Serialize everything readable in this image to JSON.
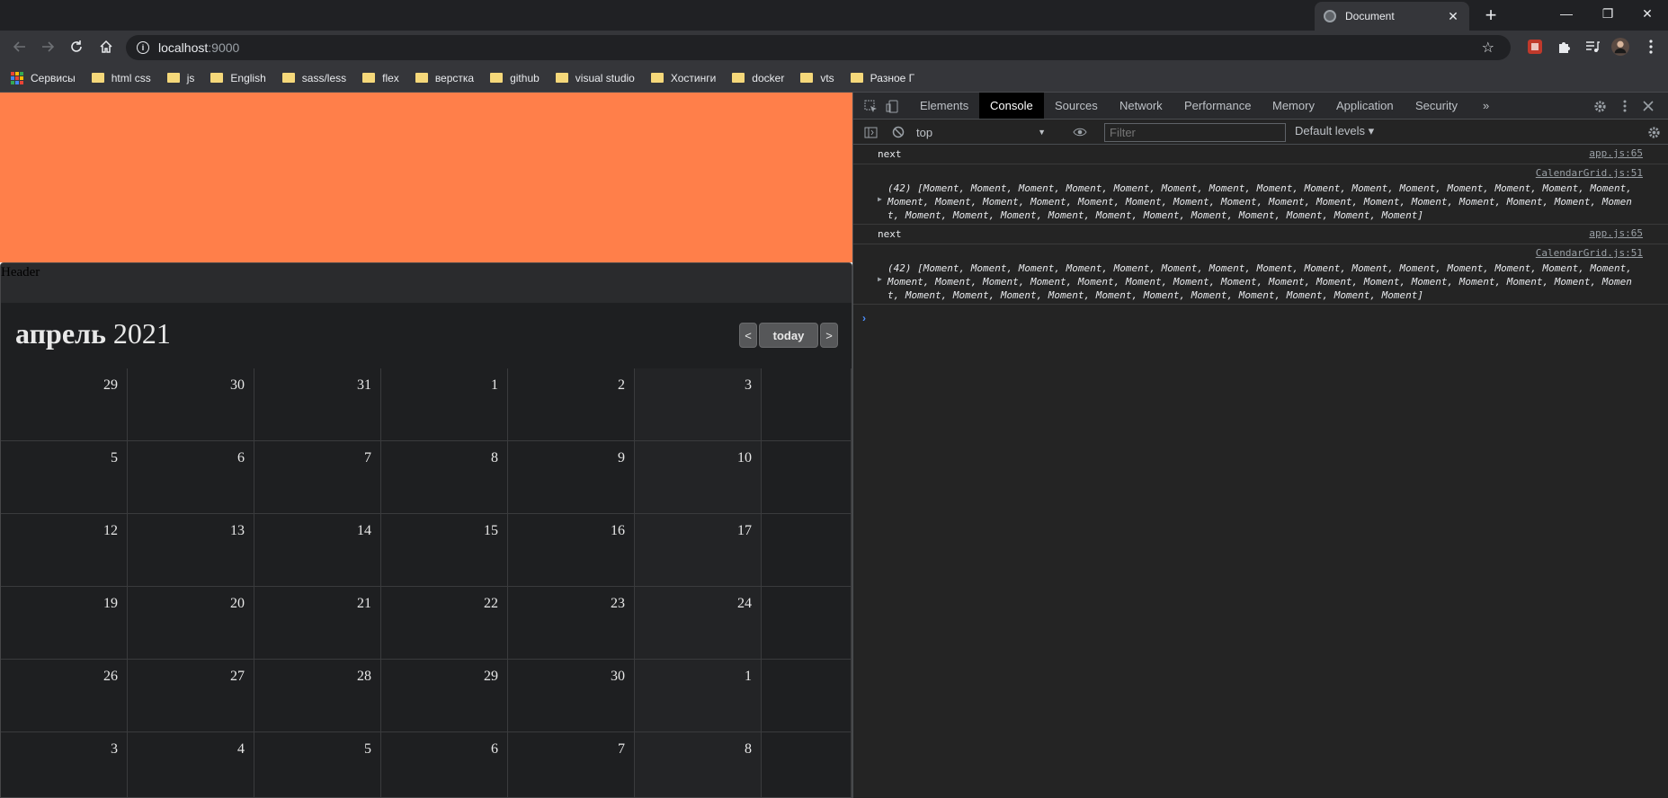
{
  "browser": {
    "tab_title": "Document",
    "tab_close": "✕",
    "new_tab": "+",
    "window_controls": [
      "—",
      "❐",
      "✕"
    ],
    "url_host": "localhost",
    "url_port": ":9000",
    "bookmarks": [
      {
        "label": "Сервисы",
        "type": "apps"
      },
      {
        "label": "html css",
        "type": "folder"
      },
      {
        "label": "js",
        "type": "folder"
      },
      {
        "label": "English",
        "type": "folder"
      },
      {
        "label": "sass/less",
        "type": "folder"
      },
      {
        "label": "flex",
        "type": "folder"
      },
      {
        "label": "верстка",
        "type": "folder"
      },
      {
        "label": "github",
        "type": "folder"
      },
      {
        "label": "visual studio",
        "type": "folder"
      },
      {
        "label": "Хостинги",
        "type": "folder"
      },
      {
        "label": "docker",
        "type": "folder"
      },
      {
        "label": "vts",
        "type": "folder"
      },
      {
        "label": "Разное Г",
        "type": "folder"
      }
    ]
  },
  "page": {
    "banner_color": "#ff7f4a",
    "header_label": "Header",
    "month_name": "апрель",
    "year": "2021",
    "prev_label": "<",
    "today_label": "today",
    "next_label": ">",
    "weeks": [
      [
        "29",
        "30",
        "31",
        "1",
        "2",
        "3",
        ""
      ],
      [
        "5",
        "6",
        "7",
        "8",
        "9",
        "10",
        ""
      ],
      [
        "12",
        "13",
        "14",
        "15",
        "16",
        "17",
        ""
      ],
      [
        "19",
        "20",
        "21",
        "22",
        "23",
        "24",
        ""
      ],
      [
        "26",
        "27",
        "28",
        "29",
        "30",
        "1",
        ""
      ],
      [
        "3",
        "4",
        "5",
        "6",
        "7",
        "8",
        ""
      ]
    ]
  },
  "devtools": {
    "tabs": [
      "Elements",
      "Console",
      "Sources",
      "Network",
      "Performance",
      "Memory",
      "Application",
      "Security"
    ],
    "active_tab": "Console",
    "more_tabs": "»",
    "context": "top",
    "filter_placeholder": "Filter",
    "levels_label": "Default levels ▾",
    "messages": [
      {
        "kind": "simple",
        "text": "next",
        "source": "app.js:65"
      },
      {
        "kind": "array",
        "text": "(42) [Moment, Moment, Moment, Moment, Moment, Moment, Moment, Moment, Moment, Moment, Moment, Moment, Moment, Moment, Moment, Moment, Moment, Moment, Moment, Moment, Moment, Moment, Moment, Moment, Moment, Moment, Moment, Moment, Moment, Moment, Moment, Moment, Moment, Moment, Moment, Moment, Moment, Moment, Moment, Moment, Moment, Moment]",
        "source": "CalendarGrid.js:51"
      },
      {
        "kind": "simple",
        "text": "next",
        "source": "app.js:65"
      },
      {
        "kind": "array",
        "text": "(42) [Moment, Moment, Moment, Moment, Moment, Moment, Moment, Moment, Moment, Moment, Moment, Moment, Moment, Moment, Moment, Moment, Moment, Moment, Moment, Moment, Moment, Moment, Moment, Moment, Moment, Moment, Moment, Moment, Moment, Moment, Moment, Moment, Moment, Moment, Moment, Moment, Moment, Moment, Moment, Moment, Moment, Moment]",
        "source": "CalendarGrid.js:51"
      }
    ],
    "prompt": "›"
  }
}
